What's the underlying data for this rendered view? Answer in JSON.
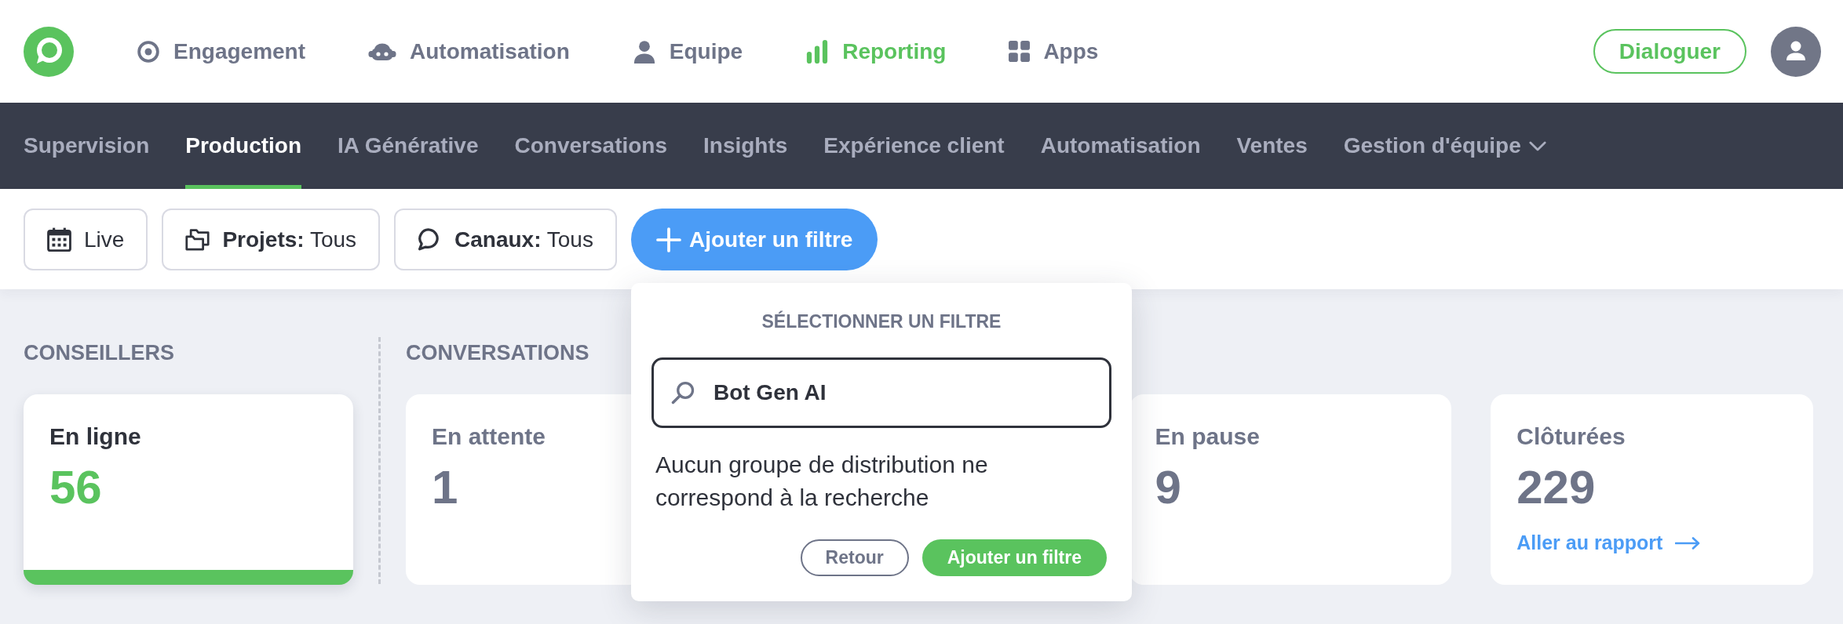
{
  "header": {
    "nav": [
      {
        "label": "Engagement",
        "selected": false
      },
      {
        "label": "Automatisation",
        "selected": false
      },
      {
        "label": "Equipe",
        "selected": false
      },
      {
        "label": "Reporting",
        "selected": true
      },
      {
        "label": "Apps",
        "selected": false
      }
    ],
    "chat_button": "Dialoguer"
  },
  "tabs": [
    {
      "label": "Supervision",
      "kind": "link",
      "selected": false
    },
    {
      "label": "Production",
      "kind": "link",
      "selected": true
    },
    {
      "label": "IA Générative",
      "kind": "link",
      "selected": false
    },
    {
      "label": "Conversations",
      "kind": "link",
      "selected": false
    },
    {
      "label": "Insights",
      "kind": "link",
      "selected": false
    },
    {
      "label": "Expérience client",
      "kind": "link",
      "selected": false
    },
    {
      "label": "Automatisation",
      "kind": "link",
      "selected": false
    },
    {
      "label": "Ventes",
      "kind": "link",
      "selected": false
    },
    {
      "label": "Gestion d'équipe",
      "kind": "menu",
      "selected": false
    }
  ],
  "filters": [
    {
      "value": "Live"
    },
    {
      "label": "Projets:",
      "value": "Tous"
    },
    {
      "label": "Canaux:",
      "value": "Tous"
    }
  ],
  "add_filter_button": "Ajouter un filtre",
  "filter_popup": {
    "title": "SÉLECTIONNER UN FILTRE",
    "search": {
      "value": "Bot Gen AI"
    },
    "message": "Aucun groupe de distribution ne correspond à la recherche",
    "buttons": [
      {
        "label": "Retour",
        "kind": "secondary"
      },
      {
        "label": "Ajouter un filtre",
        "kind": "primary"
      }
    ]
  },
  "sections": [
    {
      "title": "CONSEILLERS",
      "cards": [
        {
          "label": "En ligne",
          "value": "56",
          "selected": true
        }
      ]
    },
    {
      "title": "CONVERSATIONS",
      "cards": [
        {
          "label": "En attente",
          "value": "1",
          "selected": false
        },
        {
          "label": "En pause",
          "value": "9",
          "selected": false
        },
        {
          "label": "Clôturées",
          "value": "229",
          "selected": false,
          "link": "Aller au rapport"
        }
      ]
    }
  ]
}
